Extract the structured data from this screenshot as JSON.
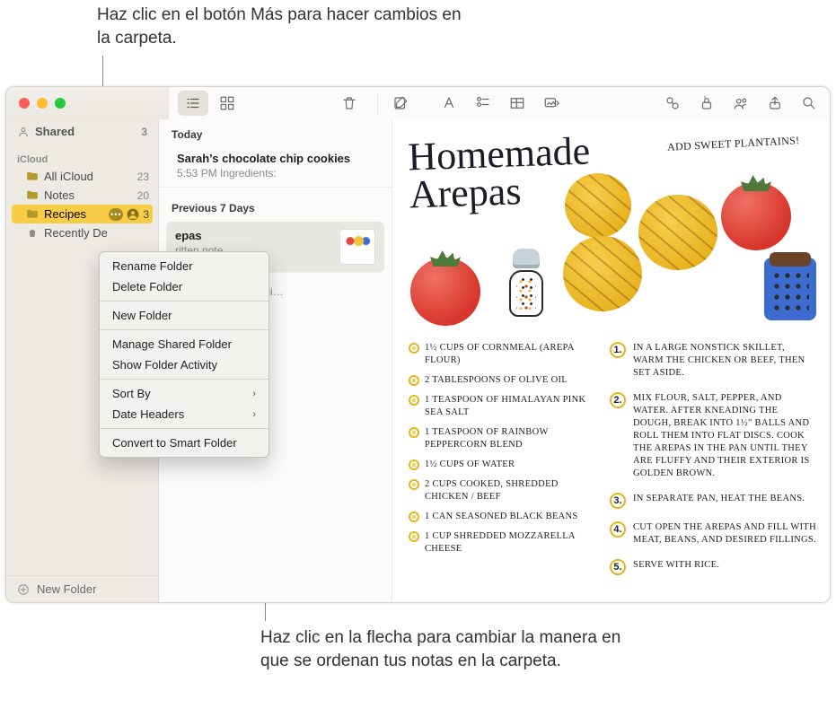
{
  "callouts": {
    "top": "Haz clic en el botón Más para hacer cambios en la carpeta.",
    "bottom": "Haz clic en la flecha para cambiar la manera en que se ordenan tus notas en la carpeta."
  },
  "sidebar": {
    "shared_label": "Shared",
    "shared_count": "3",
    "section_label": "iCloud",
    "items": [
      {
        "name": "All iCloud",
        "count": "23"
      },
      {
        "name": "Notes",
        "count": "20"
      },
      {
        "name": "Recipes",
        "count": "3",
        "selected": true,
        "shared": true
      },
      {
        "name": "Recently De",
        "count": ""
      }
    ],
    "new_folder_label": "New Folder"
  },
  "context_menu": {
    "items": [
      {
        "label": "Rename Folder"
      },
      {
        "label": "Delete Folder"
      },
      {
        "sep": true
      },
      {
        "label": "New Folder"
      },
      {
        "sep": true
      },
      {
        "label": "Manage Shared Folder"
      },
      {
        "label": "Show Folder Activity"
      },
      {
        "sep": true
      },
      {
        "label": "Sort By",
        "submenu": true
      },
      {
        "label": "Date Headers",
        "submenu": true
      },
      {
        "sep": true
      },
      {
        "label": "Convert to Smart Folder"
      }
    ]
  },
  "notes_list": {
    "groups": [
      {
        "header": "Today",
        "notes": [
          {
            "title": "Sarah’s chocolate chip cookies",
            "sub": "5:53 PM   Ingredients:"
          }
        ]
      },
      {
        "header": "Previous 7 Days",
        "notes": [
          {
            "title": "epas",
            "sub": "ritten note",
            "selected": true,
            "thumb": true
          },
          {
            "title": "",
            "sub": "cken piccata for a di…"
          }
        ]
      }
    ]
  },
  "recipe": {
    "title_line1": "Homemade",
    "title_line2": "Arepas",
    "corner_note": "ADD SWEET PLANTAINS!",
    "ingredients": [
      "1½ cups of cornmeal (arepa flour)",
      "2 tablespoons of olive oil",
      "1 teaspoon of Himalayan pink sea salt",
      "1 teaspoon of rainbow peppercorn blend",
      "1½ cups of water",
      "2 cups cooked, shredded chicken / beef",
      "1 can seasoned black beans",
      "1 cup shredded mozzarella cheese"
    ],
    "steps": [
      "In a large nonstick skillet, warm the chicken or beef, then set aside.",
      "Mix flour, salt, pepper, and water. After kneading the dough, break into 1½\" balls and roll them into flat discs. Cook the arepas in the pan until they are fluffy and their exterior is golden brown.",
      "In separate pan, heat the beans.",
      "Cut open the arepas and fill with meat, beans, and desired fillings.",
      "Serve with rice."
    ]
  }
}
